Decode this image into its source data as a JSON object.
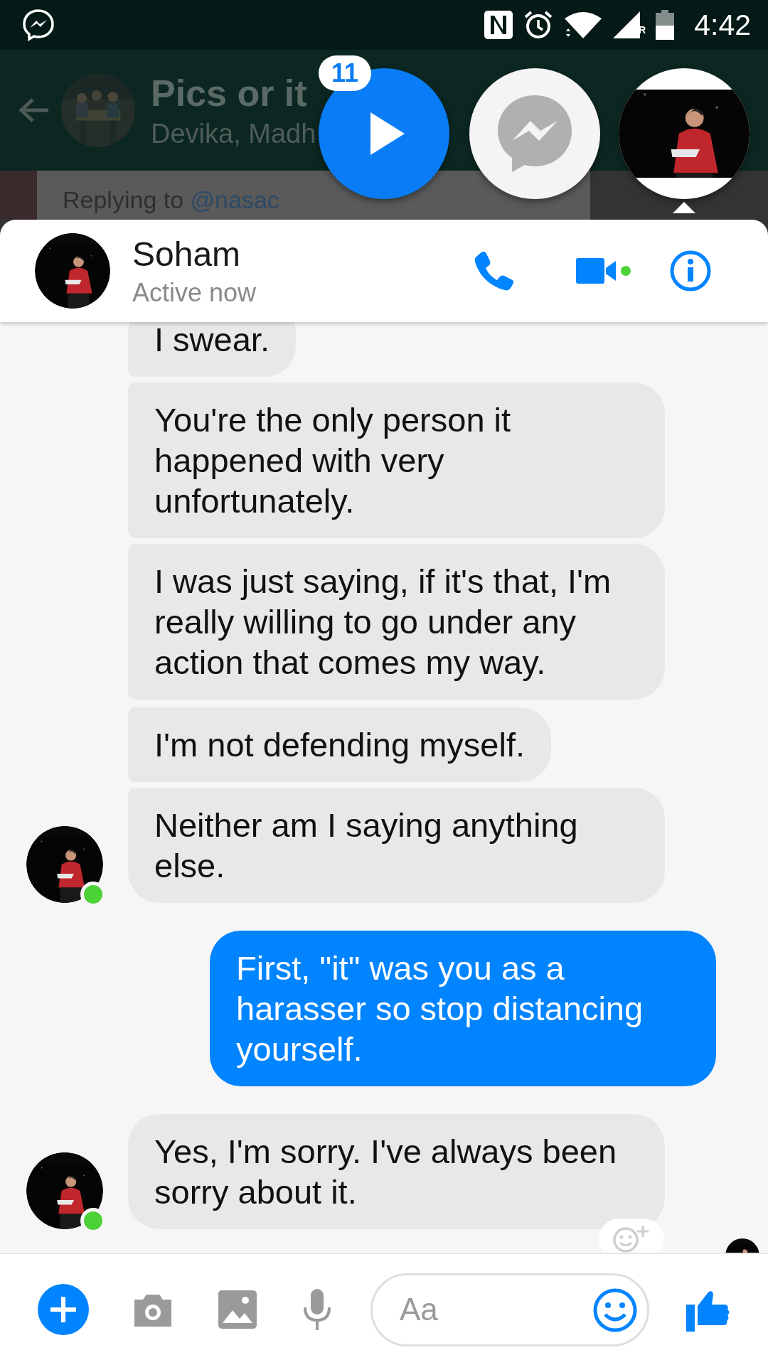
{
  "status_bar": {
    "time": "4:42",
    "network_indicator": "R"
  },
  "background_app": {
    "title": "Pics or it",
    "subtitle": "Devika, Madh",
    "reply_prefix": "Replying to",
    "reply_handle": "@nasac"
  },
  "chat_heads": [
    {
      "kind": "media",
      "badge": "11",
      "selected": false
    },
    {
      "kind": "messenger",
      "selected": false
    },
    {
      "kind": "contact",
      "selected": true
    }
  ],
  "conversation": {
    "name": "Soham",
    "status": "Active now",
    "online": true
  },
  "messages": [
    {
      "kind": "incoming",
      "text": "I swear.",
      "avatar": false
    },
    {
      "kind": "incoming",
      "text": "You're the only person it happened with very unfortunately.",
      "avatar": false
    },
    {
      "kind": "incoming",
      "text": "I was just saying, if it's that, I'm really willing to go under any action that comes my way.",
      "avatar": false
    },
    {
      "kind": "incoming",
      "text": "I'm not defending myself.",
      "avatar": false
    },
    {
      "kind": "incoming",
      "text": "Neither am I saying anything else.",
      "avatar": true
    },
    {
      "kind": "outgoing",
      "text": "First, \"it\" was you as a harasser so stop distancing yourself."
    },
    {
      "kind": "incoming",
      "text": "Yes, I'm sorry. I've always been sorry about it.",
      "avatar": true
    }
  ],
  "composer": {
    "placeholder": "Aa"
  }
}
